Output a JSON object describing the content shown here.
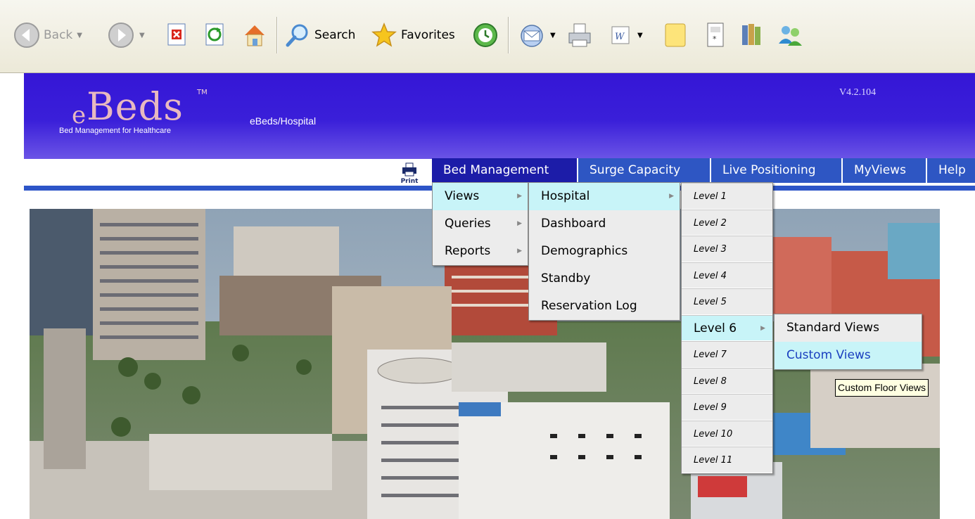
{
  "toolbar": {
    "back_label": "Back",
    "search_label": "Search",
    "favorites_label": "Favorites"
  },
  "header": {
    "logo_e": "e",
    "logo_beds": "Beds",
    "logo_tm": "TM",
    "tagline": "Bed Management for Healthcare",
    "app_path": "eBeds/Hospital",
    "version": "V4.2.104",
    "colors": {
      "banner": "#3516d6",
      "nav_tab": "#2e56c3",
      "nav_active": "#1c1ca8",
      "menu_highlight": "#c8f4f8"
    }
  },
  "print_label": "Print",
  "nav": {
    "tabs": [
      "Bed Management",
      "Surge Capacity",
      "Live Positioning",
      "MyViews",
      "Help"
    ],
    "active": "Bed Management"
  },
  "menus": {
    "bed_management": [
      "Views",
      "Queries",
      "Reports"
    ],
    "views": [
      "Hospital",
      "Dashboard",
      "Demographics",
      "Standby",
      "Reservation Log"
    ],
    "hospital_levels": [
      "Level 1",
      "Level 2",
      "Level 3",
      "Level 4",
      "Level 5",
      "Level 6",
      "Level 7",
      "Level 8",
      "Level 9",
      "Level 10",
      "Level 11"
    ],
    "level6": [
      "Standard Views",
      "Custom Views"
    ]
  },
  "tooltip": "Custom Floor Views",
  "icons": [
    "back-icon",
    "forward-icon",
    "stop-icon",
    "refresh-icon",
    "home-icon",
    "search-icon",
    "favorites-star-icon",
    "history-icon",
    "mail-icon",
    "print-icon",
    "edit-word-icon",
    "notes-icon",
    "calculator-icon",
    "research-icon",
    "messenger-icon"
  ]
}
